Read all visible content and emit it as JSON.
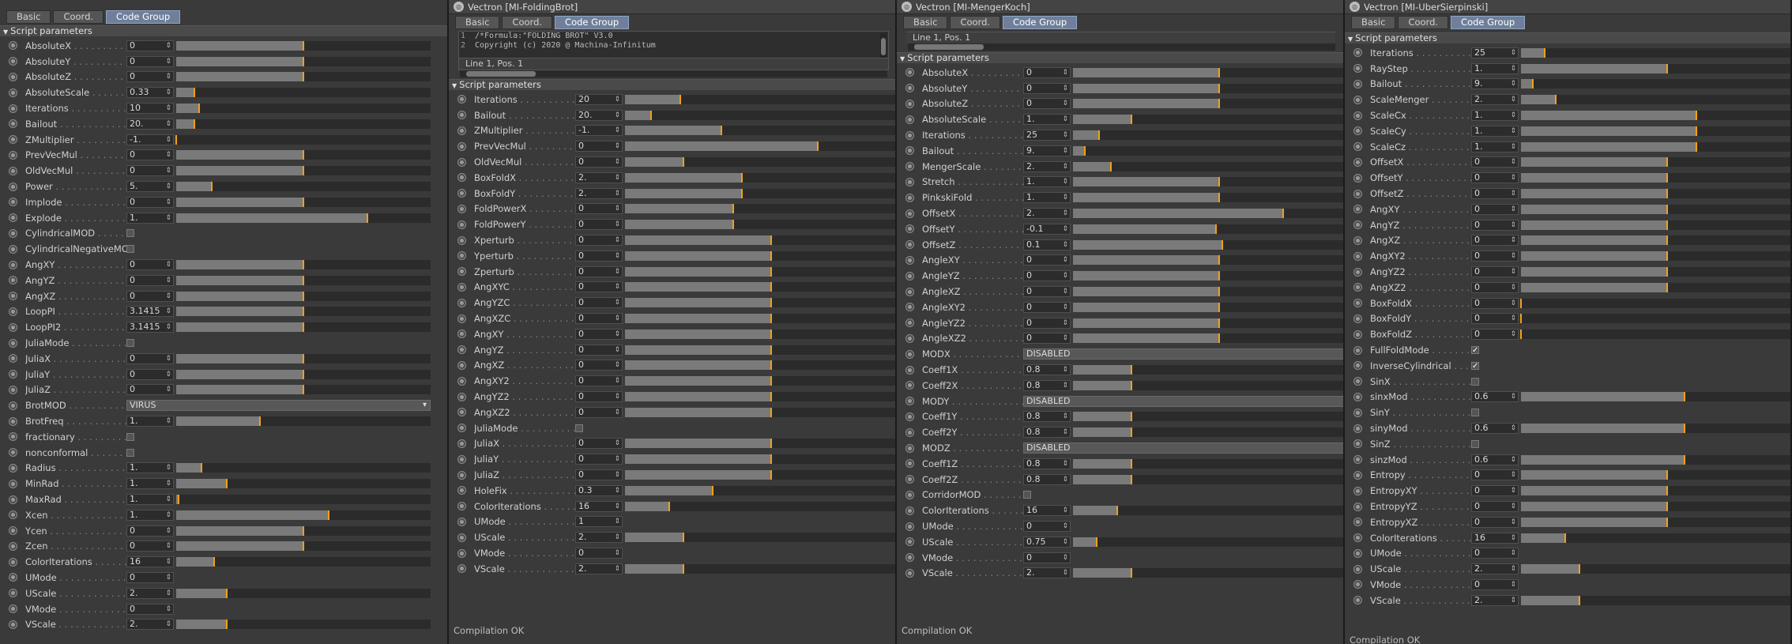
{
  "colors": {
    "accent": "#f0a01a",
    "active_tab": "#6f7f9a"
  },
  "tabs": [
    "Basic",
    "Coord.",
    "Code Group"
  ],
  "section_title": "Script parameters",
  "status": "Compilation OK",
  "panels": [
    {
      "title": "",
      "rows": [
        {
          "t": "s",
          "label": "AbsoluteX",
          "value": "0",
          "v": 0.5
        },
        {
          "t": "s",
          "label": "AbsoluteY",
          "value": "0",
          "v": 0.5
        },
        {
          "t": "s",
          "label": "AbsoluteZ",
          "value": "0",
          "v": 0.5
        },
        {
          "t": "s",
          "label": "AbsoluteScale",
          "value": "0.33",
          "v": 0.07
        },
        {
          "t": "s",
          "label": "Iterations",
          "value": "10",
          "v": 0.09
        },
        {
          "t": "s",
          "label": "Bailout",
          "value": "20.",
          "v": 0.07
        },
        {
          "t": "s",
          "label": "ZMultiplier",
          "value": "-1.",
          "v": 0.0
        },
        {
          "t": "s",
          "label": "PrevVecMul",
          "value": "0",
          "v": 0.5
        },
        {
          "t": "s",
          "label": "OldVecMul",
          "value": "0",
          "v": 0.5
        },
        {
          "t": "s",
          "label": "Power",
          "value": "5.",
          "v": 0.14
        },
        {
          "t": "s",
          "label": "Implode",
          "value": "0",
          "v": 0.5
        },
        {
          "t": "s",
          "label": "Explode",
          "value": "1.",
          "v": 0.75
        },
        {
          "t": "c",
          "label": "CylindricalMOD",
          "checked": false
        },
        {
          "t": "c",
          "label": "CylindricalNegativeMOD",
          "checked": false
        },
        {
          "t": "s",
          "label": "AngXY",
          "value": "0",
          "v": 0.5
        },
        {
          "t": "s",
          "label": "AngYZ",
          "value": "0",
          "v": 0.5
        },
        {
          "t": "s",
          "label": "AngXZ",
          "value": "0",
          "v": 0.5
        },
        {
          "t": "s",
          "label": "LoopPI",
          "value": "3.1415",
          "v": 0.5
        },
        {
          "t": "s",
          "label": "LoopPI2",
          "value": "3.1415",
          "v": 0.5
        },
        {
          "t": "c",
          "label": "JuliaMode",
          "checked": false
        },
        {
          "t": "s",
          "label": "JuliaX",
          "value": "0",
          "v": 0.5
        },
        {
          "t": "s",
          "label": "JuliaY",
          "value": "0",
          "v": 0.5
        },
        {
          "t": "s",
          "label": "JuliaZ",
          "value": "0",
          "v": 0.5
        },
        {
          "t": "d",
          "label": "BrotMOD",
          "value": "VIRUS"
        },
        {
          "t": "s",
          "label": "BrotFreq",
          "value": "1.",
          "v": 0.33
        },
        {
          "t": "c",
          "label": "fractionary",
          "checked": false
        },
        {
          "t": "c",
          "label": "nonconformal",
          "checked": false
        },
        {
          "t": "s",
          "label": "Radius",
          "value": "1.",
          "v": 0.1
        },
        {
          "t": "s",
          "label": "MinRad",
          "value": "1.",
          "v": 0.2
        },
        {
          "t": "s",
          "label": "MaxRad",
          "value": "1.",
          "v": 0.01
        },
        {
          "t": "s",
          "label": "Xcen",
          "value": "1.",
          "v": 0.6
        },
        {
          "t": "s",
          "label": "Ycen",
          "value": "0",
          "v": 0.5
        },
        {
          "t": "s",
          "label": "Zcen",
          "value": "0",
          "v": 0.5
        },
        {
          "t": "s",
          "label": "ColorIterations",
          "value": "16",
          "v": 0.15
        },
        {
          "t": "s",
          "label": "UMode",
          "value": "0",
          "v": null
        },
        {
          "t": "s",
          "label": "UScale",
          "value": "2.",
          "v": 0.2
        },
        {
          "t": "s",
          "label": "VMode",
          "value": "0",
          "v": null
        },
        {
          "t": "s",
          "label": "VScale",
          "value": "2.",
          "v": 0.2
        }
      ]
    },
    {
      "title": "Vectron [MI-FoldingBrot]",
      "editor": {
        "lines": [
          {
            "n": "1",
            "text": "/*Formula:\"FOLDING BROT\" V3.0"
          },
          {
            "n": "2",
            "text": "Copyright (c) 2020 @ Machina-Infinitum"
          }
        ],
        "pos": "Line 1, Pos. 1"
      },
      "rows": [
        {
          "t": "s",
          "label": "Iterations",
          "value": "20",
          "v": 0.19
        },
        {
          "t": "s",
          "label": "Bailout",
          "value": "20.",
          "v": 0.09
        },
        {
          "t": "s",
          "label": "ZMultiplier",
          "value": "-1.",
          "v": 0.33
        },
        {
          "t": "s",
          "label": "PrevVecMul",
          "value": "0",
          "v": 0.66
        },
        {
          "t": "s",
          "label": "OldVecMul",
          "value": "0",
          "v": 0.2
        },
        {
          "t": "s",
          "label": "BoxFoldX",
          "value": "2.",
          "v": 0.4
        },
        {
          "t": "s",
          "label": "BoxFoldY",
          "value": "2.",
          "v": 0.4
        },
        {
          "t": "s",
          "label": "FoldPowerX",
          "value": "0",
          "v": 0.37
        },
        {
          "t": "s",
          "label": "FoldPowerY",
          "value": "0",
          "v": 0.37
        },
        {
          "t": "s",
          "label": "Xperturb",
          "value": "0",
          "v": 0.5
        },
        {
          "t": "s",
          "label": "Yperturb",
          "value": "0",
          "v": 0.5
        },
        {
          "t": "s",
          "label": "Zperturb",
          "value": "0",
          "v": 0.5
        },
        {
          "t": "s",
          "label": "AngXYC",
          "value": "0",
          "v": 0.5
        },
        {
          "t": "s",
          "label": "AngYZC",
          "value": "0",
          "v": 0.5
        },
        {
          "t": "s",
          "label": "AngXZC",
          "value": "0",
          "v": 0.5
        },
        {
          "t": "s",
          "label": "AngXY",
          "value": "0",
          "v": 0.5
        },
        {
          "t": "s",
          "label": "AngYZ",
          "value": "0",
          "v": 0.5
        },
        {
          "t": "s",
          "label": "AngXZ",
          "value": "0",
          "v": 0.5
        },
        {
          "t": "s",
          "label": "AngXY2",
          "value": "0",
          "v": 0.5
        },
        {
          "t": "s",
          "label": "AngYZ2",
          "value": "0",
          "v": 0.5
        },
        {
          "t": "s",
          "label": "AngXZ2",
          "value": "0",
          "v": 0.5
        },
        {
          "t": "c",
          "label": "JuliaMode",
          "checked": false
        },
        {
          "t": "s",
          "label": "JuliaX",
          "value": "0",
          "v": 0.5
        },
        {
          "t": "s",
          "label": "JuliaY",
          "value": "0",
          "v": 0.5
        },
        {
          "t": "s",
          "label": "JuliaZ",
          "value": "0",
          "v": 0.5
        },
        {
          "t": "s",
          "label": "HoleFix",
          "value": "0.3",
          "v": 0.3
        },
        {
          "t": "s",
          "label": "ColorIterations",
          "value": "16",
          "v": 0.15
        },
        {
          "t": "s",
          "label": "UMode",
          "value": "1",
          "v": null
        },
        {
          "t": "s",
          "label": "UScale",
          "value": "2.",
          "v": 0.2
        },
        {
          "t": "s",
          "label": "VMode",
          "value": "0",
          "v": null
        },
        {
          "t": "s",
          "label": "VScale",
          "value": "2.",
          "v": 0.2
        }
      ]
    },
    {
      "title": "Vectron [MI-MengerKoch]",
      "editor": {
        "lines": [],
        "pos": "Line 1, Pos. 1"
      },
      "rows": [
        {
          "t": "s",
          "label": "AbsoluteX",
          "value": "0",
          "v": 0.5
        },
        {
          "t": "s",
          "label": "AbsoluteY",
          "value": "0",
          "v": 0.5
        },
        {
          "t": "s",
          "label": "AbsoluteZ",
          "value": "0",
          "v": 0.5
        },
        {
          "t": "s",
          "label": "AbsoluteScale",
          "value": "1.",
          "v": 0.2
        },
        {
          "t": "s",
          "label": "Iterations",
          "value": "25",
          "v": 0.09
        },
        {
          "t": "s",
          "label": "Bailout",
          "value": "9.",
          "v": 0.04
        },
        {
          "t": "s",
          "label": "MengerScale",
          "value": "2.",
          "v": 0.13
        },
        {
          "t": "s",
          "label": "Stretch",
          "value": "1.",
          "v": 0.5
        },
        {
          "t": "s",
          "label": "PinkskiFold",
          "value": "1.",
          "v": 0.5
        },
        {
          "t": "s",
          "label": "OffsetX",
          "value": "2.",
          "v": 0.72
        },
        {
          "t": "s",
          "label": "OffsetY",
          "value": "-0.1",
          "v": 0.49
        },
        {
          "t": "s",
          "label": "OffsetZ",
          "value": "0.1",
          "v": 0.51
        },
        {
          "t": "s",
          "label": "AngleXY",
          "value": "0",
          "v": 0.5
        },
        {
          "t": "s",
          "label": "AngleYZ",
          "value": "0",
          "v": 0.5
        },
        {
          "t": "s",
          "label": "AngleXZ",
          "value": "0",
          "v": 0.5
        },
        {
          "t": "s",
          "label": "AngleXY2",
          "value": "0",
          "v": 0.5
        },
        {
          "t": "s",
          "label": "AngleYZ2",
          "value": "0",
          "v": 0.5
        },
        {
          "t": "s",
          "label": "AngleXZ2",
          "value": "0",
          "v": 0.5
        },
        {
          "t": "d",
          "label": "MODX",
          "value": "DISABLED"
        },
        {
          "t": "s",
          "label": "Coeff1X",
          "value": "0.8",
          "v": 0.2
        },
        {
          "t": "s",
          "label": "Coeff2X",
          "value": "0.8",
          "v": 0.2
        },
        {
          "t": "d",
          "label": "MODY",
          "value": "DISABLED"
        },
        {
          "t": "s",
          "label": "Coeff1Y",
          "value": "0.8",
          "v": 0.2
        },
        {
          "t": "s",
          "label": "Coeff2Y",
          "value": "0.8",
          "v": 0.2
        },
        {
          "t": "d",
          "label": "MODZ",
          "value": "DISABLED"
        },
        {
          "t": "s",
          "label": "Coeff1Z",
          "value": "0.8",
          "v": 0.2
        },
        {
          "t": "s",
          "label": "Coeff2Z",
          "value": "0.8",
          "v": 0.2
        },
        {
          "t": "c",
          "label": "CorridorMOD",
          "checked": false
        },
        {
          "t": "s",
          "label": "ColorIterations",
          "value": "16",
          "v": 0.15
        },
        {
          "t": "s",
          "label": "UMode",
          "value": "0",
          "v": null
        },
        {
          "t": "s",
          "label": "UScale",
          "value": "0.75",
          "v": 0.08
        },
        {
          "t": "s",
          "label": "VMode",
          "value": "0",
          "v": null
        },
        {
          "t": "s",
          "label": "VScale",
          "value": "2.",
          "v": 0.2
        }
      ]
    },
    {
      "title": "Vectron [MI-UberSierpinski]",
      "rows": [
        {
          "t": "s",
          "label": "Iterations",
          "value": "25",
          "v": 0.08
        },
        {
          "t": "s",
          "label": "RayStep",
          "value": "1.",
          "v": 0.5
        },
        {
          "t": "s",
          "label": "Bailout",
          "value": "9.",
          "v": 0.04
        },
        {
          "t": "s",
          "label": "ScaleMenger",
          "value": "2.",
          "v": 0.12
        },
        {
          "t": "s",
          "label": "ScaleCx",
          "value": "1.",
          "v": 0.6
        },
        {
          "t": "s",
          "label": "ScaleCy",
          "value": "1.",
          "v": 0.6
        },
        {
          "t": "s",
          "label": "ScaleCz",
          "value": "1.",
          "v": 0.6
        },
        {
          "t": "s",
          "label": "OffsetX",
          "value": "0",
          "v": 0.5
        },
        {
          "t": "s",
          "label": "OffsetY",
          "value": "0",
          "v": 0.5
        },
        {
          "t": "s",
          "label": "OffsetZ",
          "value": "0",
          "v": 0.5
        },
        {
          "t": "s",
          "label": "AngXY",
          "value": "0",
          "v": 0.5
        },
        {
          "t": "s",
          "label": "AngYZ",
          "value": "0",
          "v": 0.5
        },
        {
          "t": "s",
          "label": "AngXZ",
          "value": "0",
          "v": 0.5
        },
        {
          "t": "s",
          "label": "AngXY2",
          "value": "0",
          "v": 0.5
        },
        {
          "t": "s",
          "label": "AngYZ2",
          "value": "0",
          "v": 0.5
        },
        {
          "t": "s",
          "label": "AngXZ2",
          "value": "0",
          "v": 0.5
        },
        {
          "t": "s",
          "label": "BoxFoldX",
          "value": "0",
          "v": 0.0
        },
        {
          "t": "s",
          "label": "BoxFoldY",
          "value": "0",
          "v": 0.0
        },
        {
          "t": "s",
          "label": "BoxFoldZ",
          "value": "0",
          "v": 0.0
        },
        {
          "t": "c",
          "label": "FullFoldMode",
          "checked": true
        },
        {
          "t": "c",
          "label": "InverseCylindrical",
          "checked": true
        },
        {
          "t": "c",
          "label": "SinX",
          "checked": false
        },
        {
          "t": "s",
          "label": "sinxMod",
          "value": "0.6",
          "v": 0.56
        },
        {
          "t": "c",
          "label": "SinY",
          "checked": false
        },
        {
          "t": "s",
          "label": "sinyMod",
          "value": "0.6",
          "v": 0.56
        },
        {
          "t": "c",
          "label": "SinZ",
          "checked": false
        },
        {
          "t": "s",
          "label": "sinzMod",
          "value": "0.6",
          "v": 0.56
        },
        {
          "t": "s",
          "label": "Entropy",
          "value": "0",
          "v": 0.5
        },
        {
          "t": "s",
          "label": "EntropyXY",
          "value": "0",
          "v": 0.5
        },
        {
          "t": "s",
          "label": "EntropyYZ",
          "value": "0",
          "v": 0.5
        },
        {
          "t": "s",
          "label": "EntropyXZ",
          "value": "0",
          "v": 0.5
        },
        {
          "t": "s",
          "label": "ColorIterations",
          "value": "16",
          "v": 0.15
        },
        {
          "t": "s",
          "label": "UMode",
          "value": "0",
          "v": null
        },
        {
          "t": "s",
          "label": "UScale",
          "value": "2.",
          "v": 0.2
        },
        {
          "t": "s",
          "label": "VMode",
          "value": "0",
          "v": null
        },
        {
          "t": "s",
          "label": "VScale",
          "value": "2.",
          "v": 0.2
        }
      ]
    }
  ]
}
